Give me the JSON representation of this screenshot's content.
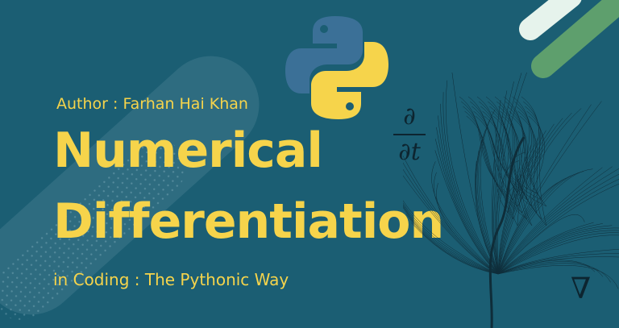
{
  "banner": {
    "author": "Author : Farhan Hai Khan",
    "title_line_1": "Numerical",
    "title_line_2": "Differentiation",
    "subtitle": "in Coding : The Pythonic Way",
    "derivative_numerator": "∂",
    "derivative_denominator": "∂t",
    "nabla": "∇"
  },
  "colors": {
    "background": "#1b5e73",
    "title": "#f6d44b",
    "python_blue": "#3b7097",
    "python_yellow": "#f6d44b",
    "corner_light": "#e6f3ec",
    "corner_green": "#5e9f6d",
    "ink": "#0d2530"
  },
  "icons": [
    "python-logo-icon",
    "fractal-art",
    "corner-decor"
  ]
}
